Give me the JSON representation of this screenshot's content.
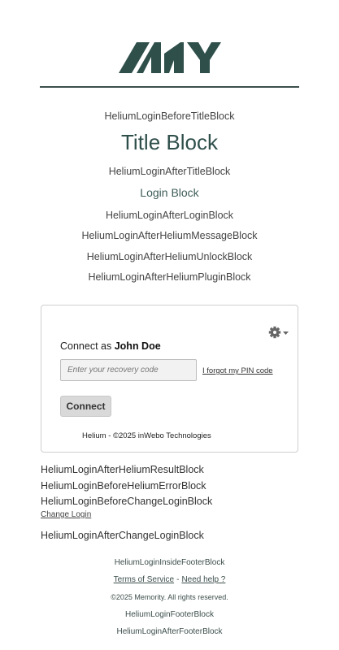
{
  "logo": {
    "alt": "MY",
    "color": "#2f4f4b"
  },
  "blocks": {
    "before_title": "HeliumLoginBeforeTitleBlock",
    "title": "Title Block",
    "after_title": "HeliumLoginAfterTitleBlock",
    "login": "Login Block",
    "after_login": "HeliumLoginAfterLoginBlock",
    "after_message": "HeliumLoginAfterHeliumMessageBlock",
    "after_unlock": "HeliumLoginAfterHeliumUnlockBlock",
    "after_plugin": "HeliumLoginAfterHeliumPluginBlock"
  },
  "card": {
    "connect_as_prefix": "Connect as",
    "user_name": "John Doe",
    "recovery_placeholder": "Enter your recovery code",
    "recovery_value": "",
    "forgot_pin": "I forgot my PIN code",
    "connect_button": "Connect",
    "copyright": "Helium - ©2025 inWebo Technologies",
    "settings_icon": "gear-icon"
  },
  "after_card": {
    "result": "HeliumLoginAfterHeliumResultBlock",
    "before_error": "HeliumLoginBeforeHeliumErrorBlock",
    "before_change": "HeliumLoginBeforeChangeLoginBlock",
    "change_login": "Change Login",
    "after_change": "HeliumLoginAfterChangeLoginBlock"
  },
  "footer": {
    "inside": "HeliumLoginInsideFooterBlock",
    "terms": "Terms of Service",
    "separator": "-",
    "help": "Need help ?",
    "rights": "©2025 Memority. All rights reserved.",
    "footer_block": "HeliumLoginFooterBlock",
    "after_footer": "HeliumLoginAfterFooterBlock"
  }
}
